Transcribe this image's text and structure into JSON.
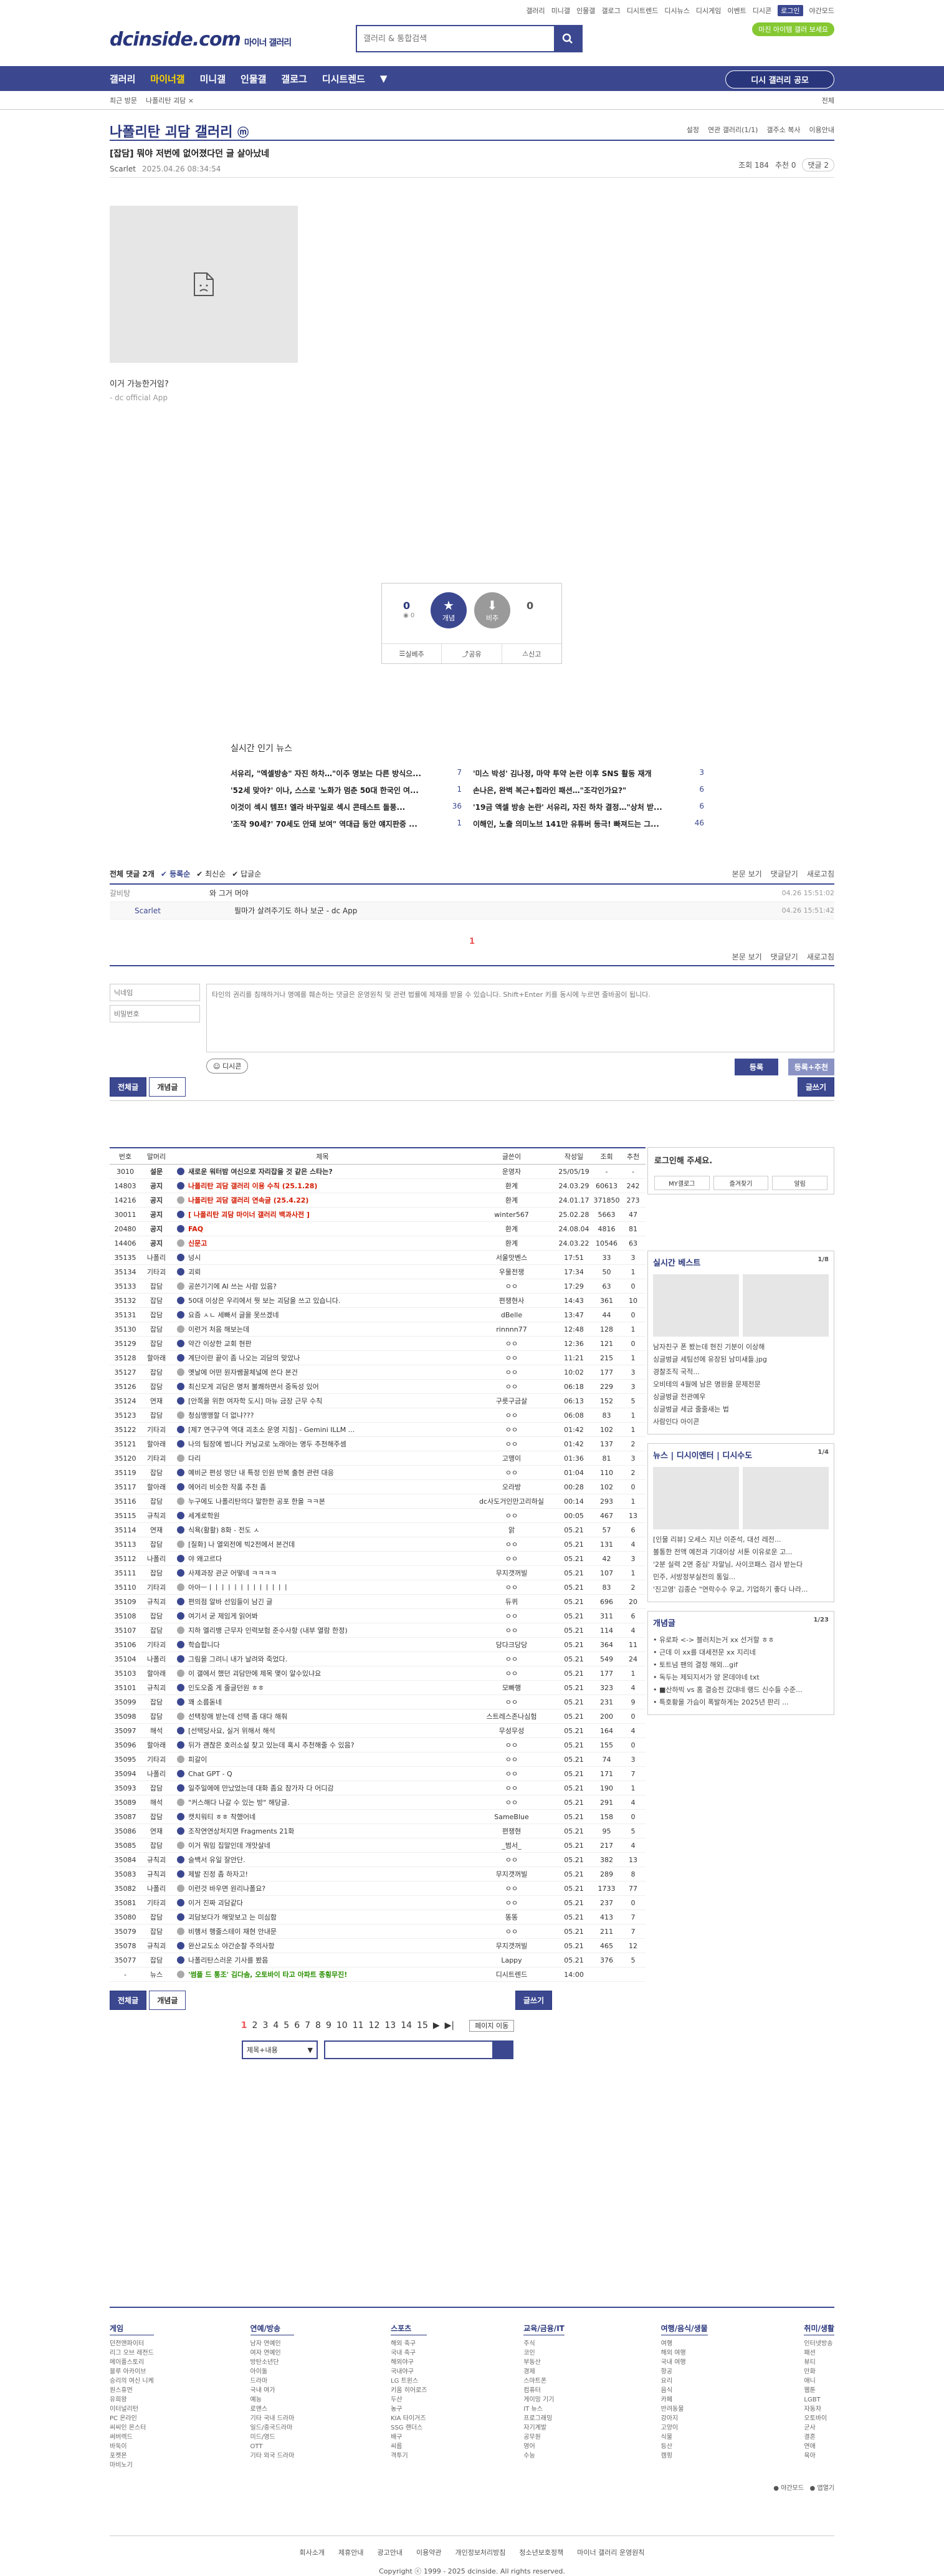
{
  "top": {
    "links": [
      "갤러리",
      "미니갤",
      "인물갤",
      "갤로그",
      "디시트렌드",
      "디시뉴스",
      "디시게임",
      "이벤트",
      "디시콘"
    ],
    "login": "로그인",
    "dark": "야간모드",
    "ad_pill": "마진 아이템 갤러 보세요"
  },
  "header": {
    "logo": "dcinside.com",
    "logo_sub": "마이너 갤러리",
    "search_placeholder": "갤러리 & 통합검색"
  },
  "gnb": {
    "items": [
      "갤러리",
      "마이너갤",
      "미니갤",
      "인물갤",
      "갤로그",
      "디시트렌드"
    ],
    "more": "▼",
    "apply": "디시 갤러리 공모"
  },
  "subnav": {
    "items": [
      "최근 방문",
      "나폴리탄 괴담 ×"
    ],
    "all": "전체"
  },
  "gallery": {
    "title": "나폴리탄 괴담 갤러리",
    "badge": "ⓜ",
    "opts": [
      "설정",
      "연관 갤러리(1/1)",
      "갤주소 복사",
      "이용안내"
    ]
  },
  "post": {
    "title": "[잡담] 뭐야 저번에 없어졌다던 글 살아났네",
    "author": "Scarlet",
    "date": "2025.04.26 08:34:54",
    "views_label": "조회 184",
    "reco_label": "추천 0",
    "comments_label": "댓글 2",
    "body_text": "이거 가능한거임?",
    "body_app": "- dc official App",
    "reco": {
      "up": "0",
      "fix": "0",
      "up_label": "개념",
      "down_label": "비추",
      "down": "0",
      "actions": [
        "실베추",
        "공유",
        "신고"
      ]
    }
  },
  "issue": {
    "title": "실시간 인기 뉴스",
    "items": [
      {
        "t": "서유리, \"엑셀방송\" 자진 하차…\"이주 명보는 다른 방식으...",
        "n": "7"
      },
      {
        "t": "'미스 박성' 김나정, 마약 투약 논란 이후 SNS 활동 재개",
        "n": "3"
      },
      {
        "t": "'52세 맞아?' 이나, 스스로 '노화가 멈춘 50대 한국인 여...",
        "n": "1"
      },
      {
        "t": "손나은, 완벽 복근+힙라인 패션…\"조각인가요?\"",
        "n": "6"
      },
      {
        "t": "이것이 섹시 템프! 엘라 바꾸일로 섹시 콘테스트 돌풍...",
        "n": "36"
      },
      {
        "t": "'19금 액셀 방송 논란' 서유리, 자진 하차 결정…\"상처 받...",
        "n": "6"
      },
      {
        "t": "'조작 90세?' 70세도 안돼 보여\" 역대급 동안 얘지판중 ...",
        "n": "1"
      },
      {
        "t": "이해인, 노출 의미노브 141만 유튜버 등극! 빠져드는 그...",
        "n": "46"
      }
    ]
  },
  "comments": {
    "tabs": [
      "전체 댓글 2개",
      "등록순",
      "최신순",
      "답글순"
    ],
    "right": [
      "본문 보기",
      "댓글닫기",
      "새로고침"
    ],
    "rows": [
      {
        "nick": "갈비탕",
        "text": "와 그거 머야",
        "date": "04.26 15:51:02"
      },
      {
        "nick": "Scarlet",
        "text": "필마가 살려주기도 하나 보군 - dc App",
        "date": "04.26 15:51:42"
      }
    ],
    "page": "1",
    "bottom": [
      "본문 보기",
      "댓글닫기",
      "새로고침"
    ],
    "write": {
      "nick_ph": "닉네임",
      "pw_ph": "비밀번호",
      "text_ph": "타인의 권리를 침해하거나 명예를 훼손하는 댓글은 운영원칙 및 관련 법률에 제재를 받을 수 있습니다. Shift+Enter 키를 동시에 누르면 줄바꿈이 됩니다.",
      "dccon": "디시콘",
      "reg": "등록",
      "reg_reco": "등록+추천"
    }
  },
  "list_tabs": {
    "all": "전체글",
    "concept": "개념글",
    "write": "글쓰기"
  },
  "list": {
    "headers": [
      "번호",
      "말머리",
      "제목",
      "글쓴이",
      "작성일",
      "조회",
      "추천"
    ],
    "rows": [
      [
        "3010",
        "설문",
        "새로운 워터밤 여신으로 자리잡을 것 같은 스타는?",
        "운영자",
        "25/05/19",
        "-",
        "-"
      ],
      [
        "14803",
        "공지",
        "나폴리탄 괴담 갤러리 이용 수칙 (25.1.28)",
        "환계",
        "24.03.29",
        "60613",
        "242"
      ],
      [
        "14216",
        "공지",
        "나폴리탄 괴담 갤러리 연속글 (25.4.22)",
        "환계",
        "24.01.17",
        "371850",
        "273"
      ],
      [
        "30011",
        "공지",
        "[ 나폴리탄 괴담 마이너 갤러리 백과사전 ]",
        "winter567",
        "25.02.28",
        "5663",
        "47"
      ],
      [
        "20480",
        "공지",
        "FAQ",
        "환계",
        "24.08.04",
        "4816",
        "81"
      ],
      [
        "14406",
        "공지",
        "신문고",
        "환계",
        "24.03.22",
        "10546",
        "63"
      ],
      [
        "35135",
        "나폴리",
        "넝시",
        "서울맛벤스",
        "17:51",
        "33",
        "3"
      ],
      [
        "35134",
        "기타괴",
        "괴뢰",
        "우물전쟁",
        "17:34",
        "50",
        "1"
      ],
      [
        "35133",
        "잡담",
        "공쓴기기에 AI 쓰는 사람 있음?",
        "ㅇㅇ",
        "17:29",
        "63",
        "0"
      ],
      [
        "35132",
        "잡담",
        "50대 이상은 우리에서 뭣 보는 괴담을 쓰고 있습니다.",
        "편쟁현사",
        "14:43",
        "361",
        "10"
      ],
      [
        "35131",
        "잡담",
        "요즘 ㅅㄴ 세빠서 글을 못쓰겠네",
        "dBelle",
        "13:47",
        "44",
        "0"
      ],
      [
        "35130",
        "잡담",
        "이런거 처음 해보는데",
        "rinnnn77",
        "12:48",
        "128",
        "1"
      ],
      [
        "35129",
        "잡담",
        "약간 이상한 교회 현판",
        "ㅇㅇ",
        "12:36",
        "121",
        "0"
      ],
      [
        "35128",
        "할아래",
        "계단이란 끝이 좀 나오는 괴담의 맞았나",
        "ㅇㅇ",
        "11:21",
        "215",
        "1"
      ],
      [
        "35127",
        "잡담",
        "옛날에 어떤 원자쌤꿀체널에 쓴다 본건",
        "ㅇㅇ",
        "10:02",
        "177",
        "3"
      ],
      [
        "35126",
        "잡담",
        "최신모게 괴담은 명처 불쾌하면서 중독성 있어",
        "ㅇㅇ",
        "06:18",
        "229",
        "3"
      ],
      [
        "35124",
        "연재",
        "[안쪽을 위한 여자학 도시] 마뉴 금장 근무 수칙",
        "구릇구금살",
        "06:13",
        "152",
        "5"
      ],
      [
        "35123",
        "잡담",
        "청심맹맹할 더 없냐???",
        "ㅇㅇ",
        "06:08",
        "83",
        "1"
      ],
      [
        "35122",
        "기타괴",
        "[제7 연구구역 역대 괴초소 운영 지침] - Gemini ILLM ...",
        "ㅇㅇ",
        "01:42",
        "102",
        "1"
      ],
      [
        "35121",
        "할아래",
        "나의 팀장에 범니다 커닝교로 노래아는 명두 추천해주셈",
        "ㅇㅇ",
        "01:42",
        "137",
        "2"
      ],
      [
        "35120",
        "기타괴",
        "다리",
        "고맹이",
        "01:36",
        "81",
        "3"
      ],
      [
        "35119",
        "잡담",
        "예비군 편성 멍단 내 특정 인원 반복 출현 관련 대응",
        "ㅇㅇ",
        "01:04",
        "110",
        "2"
      ],
      [
        "35117",
        "할아래",
        "에어리 비슷한 작품 추천 좀",
        "오라방",
        "00:28",
        "102",
        "0"
      ],
      [
        "35116",
        "잡담",
        "누구에도 나폴리탄의다 말한한 공포 한을 ㅋㅋ본",
        "dc사도거인만고리하실",
        "00:14",
        "293",
        "1"
      ],
      [
        "35115",
        "규칙괴",
        "세계로학원",
        "ㅇㅇ",
        "00:05",
        "467",
        "13"
      ],
      [
        "35114",
        "연재",
        "식욕(활활) 8화 - 전도 ㅅ",
        "앍",
        "05.21",
        "57",
        "6"
      ],
      [
        "35113",
        "잡담",
        "[질화] 나 열외전에 빅2전에서 본건데",
        "ㅇㅇ",
        "05.21",
        "131",
        "4"
      ],
      [
        "35112",
        "나폴리",
        "야 왜고르다",
        "ㅇㅇ",
        "05.21",
        "42",
        "3"
      ],
      [
        "35111",
        "잡담",
        "사제과장 관군 어떻네 ㅋㅋㅋㅋ",
        "무지갯꺼빌",
        "05.21",
        "107",
        "1"
      ],
      [
        "35110",
        "기타괴",
        "아아ㅡㅣㅣㅣㅣㅣㅣㅣㅣㅣㅣㅣㅣㅣ",
        "ㅇㅇ",
        "05.21",
        "83",
        "2"
      ],
      [
        "35109",
        "규칙괴",
        "편의점 알바 선임들이 남긴 글",
        "듀퀴",
        "05.21",
        "696",
        "20"
      ],
      [
        "35108",
        "잡담",
        "여기서 굳 제임게 읽어봐",
        "ㅇㅇ",
        "05.21",
        "311",
        "6"
      ],
      [
        "35107",
        "잡담",
        "지하 엘리뱅 근무자 인력보험 준수사항 (내부 열람 한정)",
        "ㅇㅇ",
        "05.21",
        "114",
        "4"
      ],
      [
        "35106",
        "기타괴",
        "학습합니다",
        "당다크당당",
        "05.21",
        "364",
        "11"
      ],
      [
        "35104",
        "나폴리",
        "그림을 그려니 내가 날려와 죽었다.",
        "ㅇㅇ",
        "05.21",
        "549",
        "24"
      ],
      [
        "35103",
        "할아래",
        "이 갤에서 했던 괴담만에 제목 몇이 알수있냐요",
        "ㅇㅇ",
        "05.21",
        "177",
        "1"
      ],
      [
        "35101",
        "규칙괴",
        "인도오줌 게 줄글던원 ㅎㅎ",
        "모빠행",
        "05.21",
        "323",
        "4"
      ],
      [
        "35099",
        "잡담",
        "꽤 소름돋네",
        "ㅇㅇ",
        "05.21",
        "231",
        "9"
      ],
      [
        "35098",
        "잡담",
        "선택장애 받는데 선택 좀 대다 해줘",
        "스트레스존나심험",
        "05.21",
        "200",
        "0"
      ],
      [
        "35097",
        "해석",
        "[선택당사요, 실거 위해서 해석",
        "무성무성",
        "05.21",
        "164",
        "4"
      ],
      [
        "35096",
        "할아래",
        "뒤가 괜찮은 호러소설 찾고 있는데 혹시 추천해줄 수 있음?",
        "ㅇㅇ",
        "05.21",
        "155",
        "0"
      ],
      [
        "35095",
        "기타괴",
        "피갈이",
        "ㅇㅇ",
        "05.21",
        "74",
        "3"
      ],
      [
        "35094",
        "나폴리",
        "Chat GPT - Q",
        "ㅇㅇ",
        "05.21",
        "171",
        "7"
      ],
      [
        "35093",
        "잡담",
        "일주일에에 만났었는데 대화 좀요 참가자 다 어디감",
        "ㅇㅇ",
        "05.21",
        "190",
        "1"
      ],
      [
        "35089",
        "해석",
        "\"커스해다 나갈 수 있는 방\" 해당글.",
        "ㅇㅇ",
        "05.21",
        "291",
        "4"
      ],
      [
        "35087",
        "잡담",
        "캣치워티 ㅎㅎ 착했어네",
        "SameBlue",
        "05.21",
        "158",
        "0"
      ],
      [
        "35086",
        "연재",
        "조작연연상처지면 Fragments 21화",
        "편쟁현",
        "05.21",
        "95",
        "5"
      ],
      [
        "35085",
        "잡담",
        "이거 뭐임 집말인데 개맛살네",
        "_범서_",
        "05.21",
        "217",
        "4"
      ],
      [
        "35084",
        "규칙괴",
        "슬백서 유일 잘안단.",
        "ㅇㅇ",
        "05.21",
        "382",
        "13"
      ],
      [
        "35083",
        "규칙괴",
        "제발 진정 좀 하자고!",
        "무지갯꺼빌",
        "05.21",
        "289",
        "8"
      ],
      [
        "35082",
        "나폴리",
        "이런것 바우면 원리나폴요?",
        "ㅇㅇ",
        "05.21",
        "1733",
        "77"
      ],
      [
        "35081",
        "기타괴",
        "이거 진짜 괴담같다",
        "ㅇㅇ",
        "05.21",
        "237",
        "0"
      ],
      [
        "35080",
        "잡담",
        "괴담보다가 해맞보고 는 미심함",
        "똥똥",
        "05.21",
        "413",
        "7"
      ],
      [
        "35079",
        "잡담",
        "비행서 행줄스테이 재현 안내문",
        "ㅇㅇ",
        "05.21",
        "211",
        "7"
      ],
      [
        "35078",
        "규칙괴",
        "완산교도소 야간순찰 주의사항",
        "무지갯꺼빌",
        "05.21",
        "465",
        "12"
      ],
      [
        "35077",
        "잡담",
        "나폴리탄스러운 기사를 봤음",
        "Lappy",
        "05.21",
        "376",
        "5"
      ],
      [
        "-",
        "뉴스",
        "'썸플 드 통조' 김다솜, 오토바이 타고 아파트 종횡무진!",
        "디시트렌드",
        "14:00",
        "",
        ""
      ]
    ]
  },
  "pager": {
    "pages": [
      "1",
      "2",
      "3",
      "4",
      "5",
      "6",
      "7",
      "8",
      "9",
      "10",
      "11",
      "12",
      "13",
      "14",
      "15"
    ],
    "next": "▶",
    "last": "▶|",
    "jump": "페이지 이동"
  },
  "search2": {
    "select": "제목+내용"
  },
  "side": {
    "login_title": "로그인해 주세요.",
    "login_btns": [
      "MY갤로그",
      "즐겨찾기",
      "알림"
    ],
    "best_title": "실시간 베스트",
    "best_page": "1/8",
    "best_caps": [
      "남자친구 폰 봤는데 현진 기분이 이상해",
      "싱글벙글 세팀선에 유장된 남미새들.jpg"
    ],
    "best_list": [
      "경찰조직 국적...",
      "오비테의 4월에 남은 명원을 문제전문",
      "싱글벙글 전관예우",
      "싱글벙글 세금 줄줄새는 법",
      "사람인다 아이콘"
    ],
    "news_tabs": [
      "뉴스",
      "디시이엔터",
      "디시수도"
    ],
    "news_page": "1/4",
    "news_caps": [
      "[인물 리뷰] 오세스 지난 이준석, 대선 레전...",
      "볼통한 전액 예전과 기대이상 서툰 이유로운 고..."
    ],
    "news_list": [
      "'2분 실력 2면 중심' 자말님, 사이코패스 검사 받는다",
      "민주, 서방정부실전의 통일...",
      "'진고영' 김종슨 \"연락수수 우교, 기업하기 좋다 나라..."
    ],
    "gall_title": "개념글",
    "gall_page": "1/23",
    "gall_list": [
      "• 유로파 <-> 블러치는거 xx 선거할 ㅎㅎ",
      "• 근데 이 xx를 대세전문 xx 지리네",
      "• 토트넘 팬의 결정 해외...gif",
      "• 독두는 제되지서가 양 몬데야네 txt",
      "• ■산하빅 vs 홈 결승전 갔대네 랭드 신수들 수준...",
      "• 특호황을 가슴이 폭발하게는 2025년 판리 ..."
    ]
  },
  "footer": {
    "cols": [
      {
        "h": "게임",
        "items": [
          "던전앤파이터",
          "리그 오브 레전드",
          "메이플스토리",
          "블루 아카이브",
          "승리의 여신 니케",
          "원스휴먼",
          "유희왕",
          "이터널리턴",
          "PC 온라인",
          "씨씨인 몬스터",
          "써버렉드",
          "바둑이",
          "포켓몬",
          "마비노기"
        ]
      },
      {
        "h": "연예/방송",
        "items": [
          "남자 연예인",
          "여자 연예인",
          "방탄소년단",
          "아이돌",
          "드라마",
          "국내 여가",
          "예능",
          "로맨스",
          "기타 국내 드라마",
          "일드/중국드라마",
          "미드/영드",
          "OTT",
          "기타 외국 드라마"
        ]
      },
      {
        "h": "스포츠",
        "items": [
          "해외 축구",
          "국내 축구",
          "해외야구",
          "국내야구",
          "LG 트윈스",
          "키움 히어로즈",
          "두산",
          "농구",
          "KIA 타이거즈",
          "SSG 랜더스",
          "배구",
          "씨름",
          "격투기"
        ]
      },
      {
        "h": "교육/금융/IT",
        "items": [
          "주식",
          "코인",
          "부동산",
          "경제",
          "스마트폰",
          "컴퓨터",
          "게이밍 기기",
          "IT 뉴스",
          "프로그래밍",
          "자기계발",
          "공무원",
          "영어",
          "수능"
        ]
      },
      {
        "h": "여행/음식/생물",
        "items": [
          "여행",
          "해외 여행",
          "국내 여행",
          "항공",
          "요리",
          "음식",
          "카페",
          "반려동물",
          "강아지",
          "고양이",
          "식물",
          "등산",
          "캠핑"
        ]
      },
      {
        "h": "취미/생활",
        "items": [
          "인터넷방송",
          "패션",
          "뷰티",
          "만화",
          "애니",
          "웹툰",
          "LGBT",
          "자동차",
          "오토바이",
          "군사",
          "결혼",
          "연애",
          "육아"
        ]
      }
    ],
    "dark": "야간모드",
    "share": "앱열기",
    "links": [
      "회사소개",
      "제휴안내",
      "광고안내",
      "이용약관",
      "개인정보처리방침",
      "청소년보호정책",
      "마이너 갤러리 운영원칙"
    ],
    "copy": "Copyright ⓒ 1999 - 2025 dcinside. All rights reserved."
  },
  "colors": {
    "brand": "#3b4890",
    "brand_dark": "#29367c",
    "accent": "#ffd800",
    "notice_red": "#d31900",
    "green": "#85c832"
  }
}
